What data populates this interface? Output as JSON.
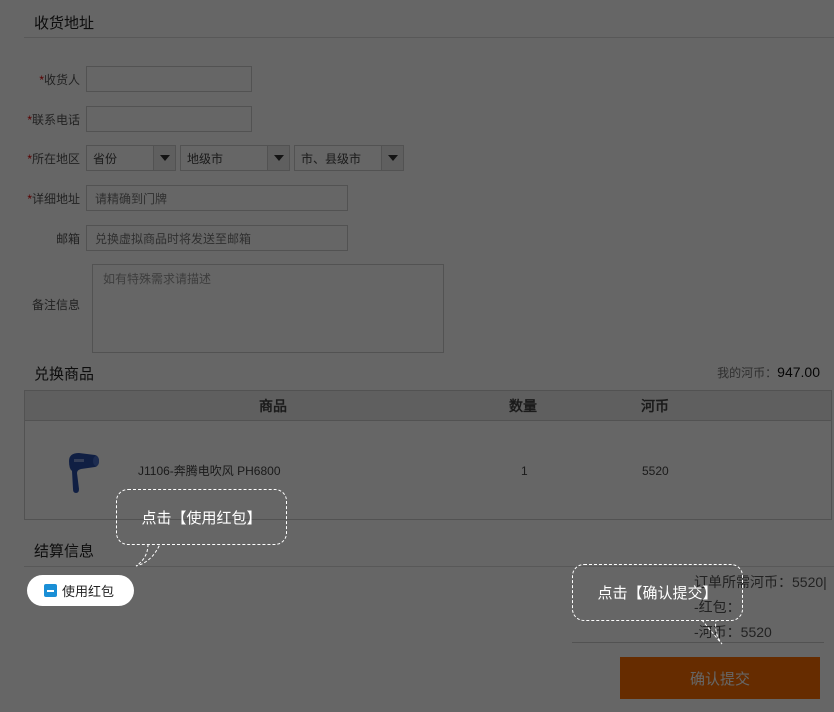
{
  "address_section": {
    "title": "收货地址",
    "required_mark": "*",
    "receiver_label": "收货人",
    "receiver_value": "",
    "phone_label": "联系电话",
    "phone_value": "",
    "region_label": "所在地区",
    "province_value": "省份",
    "city_value": "地级市",
    "district_value": "市、县级市",
    "address_label": "详细地址",
    "address_placeholder": "请精确到门牌",
    "email_label": "邮箱",
    "email_placeholder": "兑换虚拟商品时将发送至邮箱",
    "remark_label": "备注信息",
    "remark_placeholder": "如有特殊需求请描述"
  },
  "goods_section": {
    "title": "兑换商品",
    "coin_label": "我的河币：",
    "coin_value": "947.00",
    "columns": [
      "商品",
      "数量",
      "河币"
    ],
    "items": [
      {
        "name": "J1106-奔腾电吹风 PH6800",
        "qty": "1",
        "coins": "5520",
        "icon": "hair-dryer-icon"
      }
    ]
  },
  "settle_section": {
    "title": "结算信息",
    "use_redpacket_label": "使用红包",
    "order_line": "订单所需河币：5520",
    "order_line_trail": "|",
    "redpacket_line": "-红包：",
    "coins_line": "-河币：5520",
    "submit_label": "确认提交"
  },
  "tips": {
    "tip_redpacket": "点击【使用红包】",
    "tip_submit": "点击【确认提交】"
  },
  "colors": {
    "accent": "#ff6f00",
    "checkbox": "#1a8fd6",
    "overlay": "rgba(0,0,0,0.6)",
    "required": "#d00"
  }
}
